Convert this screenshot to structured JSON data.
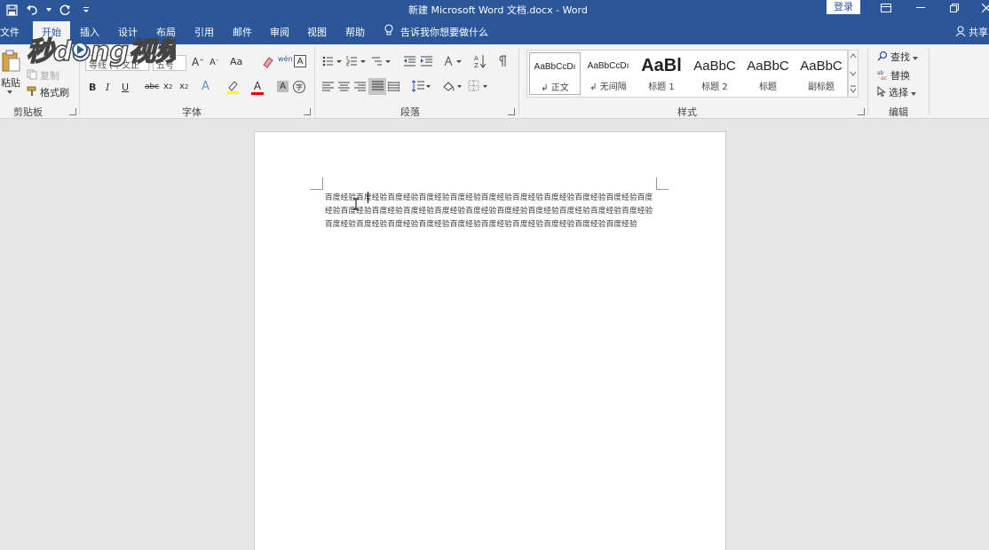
{
  "window": {
    "title": "新建 Microsoft Word 文档.docx  -  Word",
    "login": "登录",
    "share": "共享"
  },
  "tabs": [
    "文件",
    "开始",
    "插入",
    "设计",
    "布局",
    "引用",
    "邮件",
    "审阅",
    "视图",
    "帮助"
  ],
  "tell_me": "告诉我你想要做什么",
  "clipboard": {
    "paste": "粘贴",
    "copy": "复制",
    "format_painter": "格式刷",
    "label": "剪贴板"
  },
  "font": {
    "name": "等线 (中文正",
    "size": "五号",
    "label": "字体",
    "aa": "Aa",
    "wen": "wén",
    "A": "A"
  },
  "paragraph": {
    "label": "段落"
  },
  "styles": {
    "label": "样式",
    "items": [
      {
        "sample": "AaBbCcDı",
        "name": "↲ 正文"
      },
      {
        "sample": "AaBbCcDı",
        "name": "↲ 无间隔"
      },
      {
        "sample": "AaBl",
        "name": "标题 1"
      },
      {
        "sample": "AaBbC",
        "name": "标题 2"
      },
      {
        "sample": "AaBbC",
        "name": "标题"
      },
      {
        "sample": "AaBbC",
        "name": "副标题"
      }
    ]
  },
  "editing": {
    "find": "查找",
    "replace": "替换",
    "select": "选择",
    "label": "编辑"
  },
  "document": {
    "text": "百度经验百度经验百度经验百度经验百度经验百度经验百度经验百度经验百度经验百度经验百度经验百度经验百度经验百度经验百度经验百度经验百度经验百度经验百度经验百度经验百度经验百度经验百度经验百度经验百度经验百度经验百度经验百度经验百度经验百度经验百度经验"
  },
  "watermark": {
    "text": "秒懂视频"
  },
  "colors": {
    "accent": "#2b579a",
    "ribbon": "#f3f3f3",
    "canvas": "#e6e6e6",
    "page": "#ffffff"
  }
}
